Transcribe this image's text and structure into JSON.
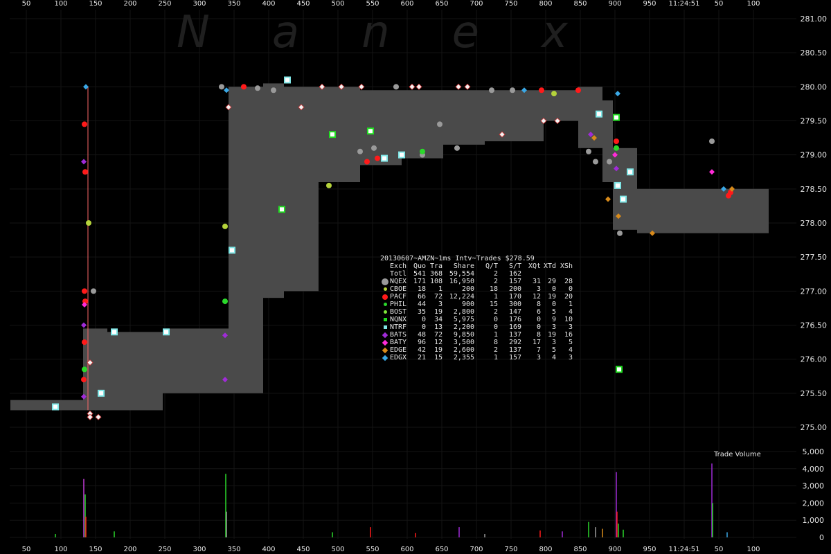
{
  "watermark": "Nanex",
  "clock": "11:24:51",
  "stats": {
    "title": "20130607~AMZN~1ms Intv~Trades $278.59",
    "headers": [
      "Exch",
      "Quo",
      "Tra",
      "Share",
      "Q/T",
      "S/T",
      "XQt",
      "XTd",
      "XSh"
    ],
    "rows": [
      {
        "exch": "Totl",
        "quo": "541",
        "tra": "368",
        "share": "59,554",
        "qt": "2",
        "st": "162",
        "xqt": "",
        "xtd": "",
        "xsh": "",
        "color": "",
        "shape": "none"
      },
      {
        "exch": "NQEX",
        "quo": "171",
        "tra": "108",
        "share": "16,950",
        "qt": "2",
        "st": "157",
        "xqt": "31",
        "xtd": "29",
        "xsh": "28",
        "color": "#9a9a9a",
        "shape": "circle-lg"
      },
      {
        "exch": "CBOE",
        "quo": "18",
        "tra": "1",
        "share": "200",
        "qt": "18",
        "st": "200",
        "xqt": "3",
        "xtd": "0",
        "xsh": "0",
        "color": "#b5d33b",
        "shape": "circle-sm"
      },
      {
        "exch": "PACF",
        "quo": "66",
        "tra": "72",
        "share": "12,224",
        "qt": "1",
        "st": "170",
        "xqt": "12",
        "xtd": "19",
        "xsh": "20",
        "color": "#ff1a1a",
        "shape": "circle-md"
      },
      {
        "exch": "PHIL",
        "quo": "44",
        "tra": "3",
        "share": "900",
        "qt": "15",
        "st": "300",
        "xqt": "8",
        "xtd": "0",
        "xsh": "1",
        "color": "#2bd82b",
        "shape": "circle-sm"
      },
      {
        "exch": "BOST",
        "quo": "35",
        "tra": "19",
        "share": "2,800",
        "qt": "2",
        "st": "147",
        "xqt": "6",
        "xtd": "5",
        "xsh": "4",
        "color": "#7fe63a",
        "shape": "circle-sm"
      },
      {
        "exch": "NQNX",
        "quo": "0",
        "tra": "34",
        "share": "5,975",
        "qt": "0",
        "st": "176",
        "xqt": "0",
        "xtd": "9",
        "xsh": "10",
        "color": "#22dd22",
        "shape": "square"
      },
      {
        "exch": "NTRF",
        "quo": "0",
        "tra": "13",
        "share": "2,200",
        "qt": "0",
        "st": "169",
        "xqt": "0",
        "xtd": "3",
        "xsh": "3",
        "color": "#7fe6e6",
        "shape": "square"
      },
      {
        "exch": "BATS",
        "quo": "48",
        "tra": "72",
        "share": "9,850",
        "qt": "1",
        "st": "137",
        "xqt": "8",
        "xtd": "19",
        "xsh": "16",
        "color": "#a02bd8",
        "shape": "diamond"
      },
      {
        "exch": "BATY",
        "quo": "96",
        "tra": "12",
        "share": "3,500",
        "qt": "8",
        "st": "292",
        "xqt": "17",
        "xtd": "3",
        "xsh": "5",
        "color": "#ff2bd8",
        "shape": "diamond"
      },
      {
        "exch": "EDGE",
        "quo": "42",
        "tra": "19",
        "share": "2,600",
        "qt": "2",
        "st": "137",
        "xqt": "7",
        "xtd": "5",
        "xsh": "4",
        "color": "#d88a1a",
        "shape": "diamond"
      },
      {
        "exch": "EDGX",
        "quo": "21",
        "tra": "15",
        "share": "2,355",
        "qt": "1",
        "st": "157",
        "xqt": "3",
        "xtd": "4",
        "xsh": "3",
        "color": "#3aa8e6",
        "shape": "diamond"
      }
    ]
  },
  "chart_data": {
    "type": "scatter",
    "title": "20130607~AMZN~1ms Intv~Trades $278.59",
    "x_ticks": [
      "50",
      "100",
      "150",
      "200",
      "250",
      "300",
      "350",
      "400",
      "450",
      "500",
      "550",
      "600",
      "650",
      "700",
      "750",
      "800",
      "850",
      "900",
      "950",
      "11:24:51",
      "50",
      "100"
    ],
    "price_axis": {
      "ticks": [
        275.0,
        275.5,
        276.0,
        276.5,
        277.0,
        277.5,
        278.0,
        278.5,
        279.0,
        279.5,
        280.0,
        280.5,
        281.0
      ],
      "ylim": [
        274.75,
        281.25
      ]
    },
    "volume_axis": {
      "label": "Trade Volume",
      "ticks": [
        "0",
        "1,000",
        "2,000",
        "3,000",
        "4,000",
        "5,000"
      ],
      "ylim": [
        0,
        5000
      ]
    },
    "nbbo_band": [
      {
        "x": [
          15,
          120
        ],
        "bid": 275.25,
        "ask": 275.4
      },
      {
        "x": [
          120,
          155
        ],
        "bid": 275.25,
        "ask": 276.45
      },
      {
        "x": [
          155,
          235
        ],
        "bid": 275.25,
        "ask": 276.4
      },
      {
        "x": [
          235,
          330
        ],
        "bid": 275.5,
        "ask": 276.45
      },
      {
        "x": [
          330,
          380
        ],
        "bid": 275.5,
        "ask": 280.0
      },
      {
        "x": [
          380,
          410
        ],
        "bid": 276.9,
        "ask": 280.05
      },
      {
        "x": [
          410,
          460
        ],
        "bid": 277.0,
        "ask": 280.0
      },
      {
        "x": [
          460,
          520
        ],
        "bid": 278.6,
        "ask": 280.0
      },
      {
        "x": [
          520,
          580
        ],
        "bid": 278.85,
        "ask": 279.95
      },
      {
        "x": [
          580,
          640
        ],
        "bid": 278.95,
        "ask": 279.95
      },
      {
        "x": [
          640,
          700
        ],
        "bid": 279.15,
        "ask": 279.95
      },
      {
        "x": [
          700,
          785
        ],
        "bid": 279.2,
        "ask": 279.95
      },
      {
        "x": [
          785,
          835
        ],
        "bid": 279.5,
        "ask": 279.95
      },
      {
        "x": [
          835,
          870
        ],
        "bid": 279.1,
        "ask": 280.0
      },
      {
        "x": [
          870,
          885
        ],
        "bid": 278.6,
        "ask": 279.8
      },
      {
        "x": [
          885,
          920
        ],
        "bid": 277.9,
        "ask": 279.1
      },
      {
        "x": [
          920,
          1110
        ],
        "bid": 277.85,
        "ask": 278.5
      }
    ],
    "series": [
      {
        "name": "NQEX",
        "color": "#9a9a9a",
        "shape": "circle",
        "points": [
          [
            135,
            277.0
          ],
          [
            320,
            280.0
          ],
          [
            372,
            279.98
          ],
          [
            395,
            279.95
          ],
          [
            520,
            279.05
          ],
          [
            540,
            279.1
          ],
          [
            572,
            280.0
          ],
          [
            610,
            279.0
          ],
          [
            635,
            279.45
          ],
          [
            660,
            279.1
          ],
          [
            710,
            279.95
          ],
          [
            740,
            279.95
          ],
          [
            850,
            279.05
          ],
          [
            860,
            278.9
          ],
          [
            880,
            278.9
          ],
          [
            1028,
            279.2
          ],
          [
            895,
            277.85
          ]
        ]
      },
      {
        "name": "CBOE",
        "color": "#b5d33b",
        "shape": "circle",
        "points": [
          [
            128,
            278.0
          ],
          [
            325,
            277.95
          ],
          [
            475,
            278.55
          ],
          [
            800,
            279.9
          ]
        ]
      },
      {
        "name": "PACF",
        "color": "#ff1a1a",
        "shape": "circle",
        "points": [
          [
            122,
            279.45
          ],
          [
            123,
            278.75
          ],
          [
            122,
            277.0
          ],
          [
            123,
            276.85
          ],
          [
            122,
            276.25
          ],
          [
            121,
            275.7
          ],
          [
            352,
            280.0
          ],
          [
            530,
            278.9
          ],
          [
            545,
            278.95
          ],
          [
            782,
            279.95
          ],
          [
            835,
            279.95
          ],
          [
            890,
            279.2
          ],
          [
            1055,
            278.45
          ],
          [
            1052,
            278.4
          ]
        ]
      },
      {
        "name": "PHIL",
        "color": "#2bd82b",
        "shape": "circle",
        "points": [
          [
            122,
            275.85
          ],
          [
            325,
            276.85
          ],
          [
            890,
            279.1
          ],
          [
            610,
            279.05
          ]
        ]
      },
      {
        "name": "NQNX",
        "color": "#22dd22",
        "shape": "square",
        "points": [
          [
            894,
            275.85
          ],
          [
            890,
            279.55
          ],
          [
            407,
            278.2
          ],
          [
            535,
            279.35
          ],
          [
            480,
            279.3
          ]
        ]
      },
      {
        "name": "NTRF",
        "color": "#7fe6e6",
        "shape": "square",
        "points": [
          [
            80,
            275.3
          ],
          [
            146,
            275.5
          ],
          [
            165,
            276.4
          ],
          [
            240,
            276.4
          ],
          [
            335,
            277.6
          ],
          [
            415,
            280.1
          ],
          [
            555,
            278.95
          ],
          [
            580,
            279.0
          ],
          [
            865,
            279.6
          ],
          [
            910,
            278.75
          ],
          [
            892,
            278.55
          ],
          [
            900,
            278.35
          ]
        ]
      },
      {
        "name": "BATS",
        "color": "#a02bd8",
        "shape": "diamond",
        "points": [
          [
            121,
            278.9
          ],
          [
            121,
            276.5
          ],
          [
            121,
            275.45
          ],
          [
            325,
            275.7
          ],
          [
            325,
            276.35
          ],
          [
            890,
            278.8
          ],
          [
            853,
            279.3
          ]
        ]
      },
      {
        "name": "BATY",
        "color": "#ff2bd8",
        "shape": "diamond",
        "points": [
          [
            122,
            276.8
          ],
          [
            888,
            279.0
          ],
          [
            1028,
            278.75
          ]
        ]
      },
      {
        "name": "EDGE",
        "color": "#d88a1a",
        "shape": "diamond",
        "points": [
          [
            858,
            279.25
          ],
          [
            878,
            278.35
          ],
          [
            893,
            278.1
          ],
          [
            942,
            277.85
          ],
          [
            1057,
            278.5
          ]
        ]
      },
      {
        "name": "EDGX",
        "color": "#3aa8e6",
        "shape": "diamond",
        "points": [
          [
            124,
            280.0
          ],
          [
            327,
            279.95
          ],
          [
            757,
            279.95
          ],
          [
            892,
            279.9
          ],
          [
            1045,
            278.5
          ]
        ]
      },
      {
        "name": "Other",
        "color": "#f2f2f2",
        "shape": "diamond",
        "points": [
          [
            130,
            275.2
          ],
          [
            130,
            275.95
          ],
          [
            330,
            279.7
          ],
          [
            435,
            279.7
          ],
          [
            465,
            280.0
          ],
          [
            493,
            280.0
          ],
          [
            522,
            280.0
          ],
          [
            595,
            280.0
          ],
          [
            605,
            280.0
          ],
          [
            662,
            280.0
          ],
          [
            675,
            280.0
          ],
          [
            725,
            279.3
          ],
          [
            785,
            279.5
          ],
          [
            805,
            279.5
          ],
          [
            130,
            275.15
          ],
          [
            142,
            275.15
          ]
        ]
      }
    ],
    "volume_spikes": [
      {
        "x": 121,
        "v": 3400,
        "color": "#c23bd8"
      },
      {
        "x": 123,
        "v": 2500,
        "color": "#2bd82b"
      },
      {
        "x": 124,
        "v": 1200,
        "color": "#ff1a1a"
      },
      {
        "x": 326,
        "v": 3700,
        "color": "#2bd82b"
      },
      {
        "x": 327,
        "v": 1500,
        "color": "#9a9a9a"
      },
      {
        "x": 890,
        "v": 3800,
        "color": "#a02bd8"
      },
      {
        "x": 891,
        "v": 1500,
        "color": "#ff1a1a"
      },
      {
        "x": 893,
        "v": 800,
        "color": "#2bd82b"
      },
      {
        "x": 1028,
        "v": 4300,
        "color": "#a02bd8"
      },
      {
        "x": 1029,
        "v": 2000,
        "color": "#2bd82b"
      },
      {
        "x": 850,
        "v": 900,
        "color": "#2bd82b"
      },
      {
        "x": 860,
        "v": 600,
        "color": "#9a9a9a"
      },
      {
        "x": 535,
        "v": 600,
        "color": "#ff1a1a"
      },
      {
        "x": 663,
        "v": 600,
        "color": "#a02bd8"
      },
      {
        "x": 780,
        "v": 400,
        "color": "#ff1a1a"
      },
      {
        "x": 480,
        "v": 300,
        "color": "#2bd82b"
      },
      {
        "x": 812,
        "v": 350,
        "color": "#a02bd8"
      },
      {
        "x": 1050,
        "v": 300,
        "color": "#3aa8e6"
      },
      {
        "x": 165,
        "v": 350,
        "color": "#2bd82b"
      },
      {
        "x": 80,
        "v": 200,
        "color": "#2bd82b"
      },
      {
        "x": 600,
        "v": 250,
        "color": "#ff1a1a"
      },
      {
        "x": 700,
        "v": 200,
        "color": "#9a9a9a"
      },
      {
        "x": 900,
        "v": 450,
        "color": "#2bd82b"
      },
      {
        "x": 870,
        "v": 500,
        "color": "#d88a1a"
      }
    ]
  }
}
